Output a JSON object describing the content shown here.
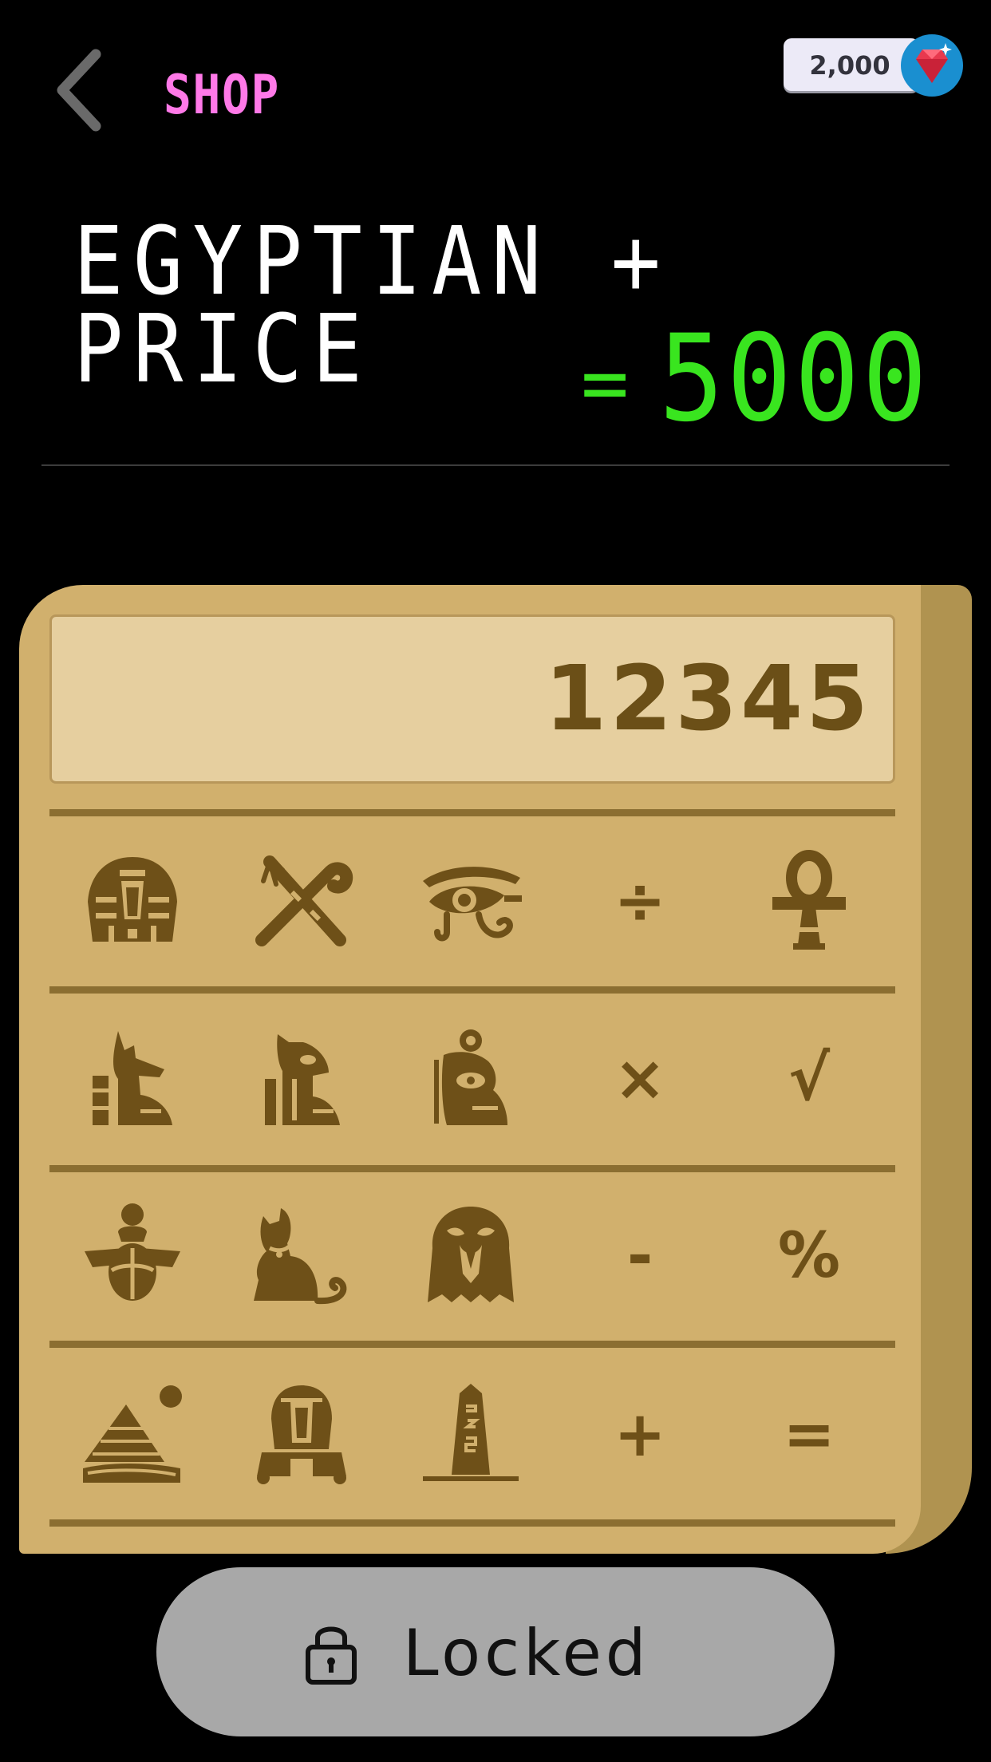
{
  "header": {
    "back_icon": "chevron-left-icon",
    "title": "SHOP",
    "gem_count": "2,000",
    "gem_icon": "gem-icon"
  },
  "banner": {
    "theme_line": "EGYPTIAN + PRICE",
    "equals": "=",
    "price": "5000"
  },
  "calculator": {
    "display_value": "12345",
    "keys": [
      [
        {
          "icon": "pharaoh-head-icon",
          "label": ""
        },
        {
          "icon": "crook-and-flail-icon",
          "label": ""
        },
        {
          "icon": "eye-of-horus-icon",
          "label": ""
        },
        {
          "icon": "divide-icon",
          "label": "÷"
        },
        {
          "icon": "ankh-icon",
          "label": ""
        }
      ],
      [
        {
          "icon": "anubis-icon",
          "label": ""
        },
        {
          "icon": "seated-god-icon",
          "label": ""
        },
        {
          "icon": "thoth-icon",
          "label": ""
        },
        {
          "icon": "multiply-icon",
          "label": "×"
        },
        {
          "icon": "square-root-icon",
          "label": "√"
        }
      ],
      [
        {
          "icon": "scarab-icon",
          "label": ""
        },
        {
          "icon": "cat-bastet-icon",
          "label": ""
        },
        {
          "icon": "horus-falcon-icon",
          "label": ""
        },
        {
          "icon": "minus-icon",
          "label": "-"
        },
        {
          "icon": "percent-icon",
          "label": "%"
        }
      ],
      [
        {
          "icon": "pyramid-icon",
          "label": ""
        },
        {
          "icon": "sphinx-icon",
          "label": ""
        },
        {
          "icon": "obelisk-icon",
          "label": ""
        },
        {
          "icon": "plus-icon",
          "label": "+"
        },
        {
          "icon": "equals-icon",
          "label": "="
        }
      ]
    ]
  },
  "purchase": {
    "status_label": "Locked",
    "lock_icon": "lock-icon"
  },
  "colors": {
    "background": "#000000",
    "title_pink": "#ff79e8",
    "price_green": "#39e51f",
    "papyrus": "#d1b06d",
    "papyrus_dark": "#6e5018",
    "locked_gray": "#a8a8a8"
  }
}
